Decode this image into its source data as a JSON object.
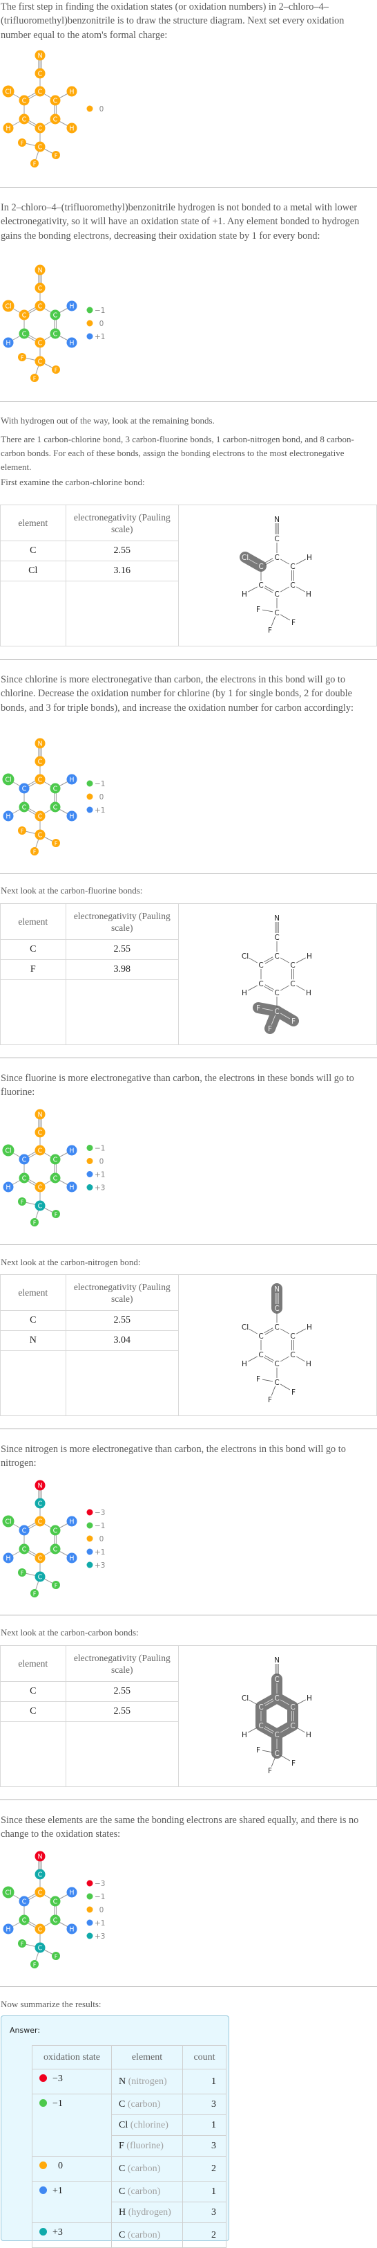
{
  "colors": {
    "minus3": "#f0001e",
    "minus1": "#4cc94c",
    "zero": "#ffa90a",
    "plus1": "#3f88f2",
    "plus3": "#11aaaa",
    "highlight": "#7a7a7a"
  },
  "sections": {
    "intro": {
      "text": "The first step in finding the oxidation states (or oxidation numbers) in 2–chloro–4–(trifluoromethyl)benzonitrile is to draw the structure diagram. Next set every oxidation number equal to the atom's formal charge:",
      "legend": [
        {
          "label": "0",
          "color_key": "zero"
        }
      ]
    },
    "hydrogen": {
      "text": "In 2–chloro–4–(trifluoromethyl)benzonitrile hydrogen is not bonded to a metal with lower electronegativity, so it will have an oxidation state of +1. Any element bonded to hydrogen gains the bonding electrons, decreasing their oxidation state by 1 for every bond:",
      "legend": [
        {
          "label": "−1",
          "color_key": "minus1"
        },
        {
          "label": "0",
          "color_key": "zero"
        },
        {
          "label": "+1",
          "color_key": "plus1"
        }
      ]
    },
    "remaining": {
      "line1": "With hydrogen out of the way, look at the remaining bonds.",
      "line2": "There are 1 carbon-chlorine bond, 3 carbon-fluorine bonds, 1 carbon-nitrogen bond, and 8 carbon-carbon bonds.  For each of these bonds, assign the bonding electrons to the most electronegative element.",
      "line3": "First examine the carbon-chlorine bond:"
    },
    "table_headers": {
      "element": "element",
      "electronegativity": "electronegativity (Pauling scale)"
    },
    "cl_table": {
      "rows": [
        {
          "element": "C",
          "value": "2.55"
        },
        {
          "element": "Cl",
          "value": "3.16"
        }
      ]
    },
    "chlorine": {
      "text": "Since chlorine is more electronegative than carbon, the electrons in this bond will go to chlorine. Decrease the oxidation number for chlorine (by 1 for single bonds, 2 for double bonds, and 3 for triple bonds), and increase the oxidation number for carbon accordingly:",
      "legend": [
        {
          "label": "−1",
          "color_key": "minus1"
        },
        {
          "label": "0",
          "color_key": "zero"
        },
        {
          "label": "+1",
          "color_key": "plus1"
        }
      ]
    },
    "f_intro": "Next look at the carbon-fluorine bonds:",
    "f_table": {
      "rows": [
        {
          "element": "C",
          "value": "2.55"
        },
        {
          "element": "F",
          "value": "3.98"
        }
      ]
    },
    "fluorine": {
      "text": "Since fluorine is more electronegative than carbon, the electrons in these bonds will go to fluorine:",
      "legend": [
        {
          "label": "−1",
          "color_key": "minus1"
        },
        {
          "label": "0",
          "color_key": "zero"
        },
        {
          "label": "+1",
          "color_key": "plus1"
        },
        {
          "label": "+3",
          "color_key": "plus3"
        }
      ]
    },
    "n_intro": "Next look at the carbon-nitrogen bond:",
    "n_table": {
      "rows": [
        {
          "element": "C",
          "value": "2.55"
        },
        {
          "element": "N",
          "value": "3.04"
        }
      ]
    },
    "nitrogen": {
      "text": "Since nitrogen is more electronegative than carbon, the electrons in this bond will go to nitrogen:",
      "legend": [
        {
          "label": "−3",
          "color_key": "minus3"
        },
        {
          "label": "−1",
          "color_key": "minus1"
        },
        {
          "label": "0",
          "color_key": "zero"
        },
        {
          "label": "+1",
          "color_key": "plus1"
        },
        {
          "label": "+3",
          "color_key": "plus3"
        }
      ]
    },
    "c_intro": "Next look at the carbon-carbon bonds:",
    "c_table": {
      "rows": [
        {
          "element": "C",
          "value": "2.55"
        },
        {
          "element": "C",
          "value": "2.55"
        }
      ]
    },
    "carbon": {
      "text": "Since these elements are the same the bonding electrons are shared equally, and there is no change to the oxidation states:",
      "legend": [
        {
          "label": "−3",
          "color_key": "minus3"
        },
        {
          "label": "−1",
          "color_key": "minus1"
        },
        {
          "label": "0",
          "color_key": "zero"
        },
        {
          "label": "+1",
          "color_key": "plus1"
        },
        {
          "label": "+3",
          "color_key": "plus3"
        }
      ]
    },
    "summary_intro": "Now summarize the results:"
  },
  "molecule": {
    "atoms": [
      {
        "id": "N",
        "label": "N"
      },
      {
        "id": "Cn",
        "label": "C"
      },
      {
        "id": "C1",
        "label": "C"
      },
      {
        "id": "Cl",
        "label": "Cl"
      },
      {
        "id": "C2",
        "label": "C"
      },
      {
        "id": "C6",
        "label": "C"
      },
      {
        "id": "H6",
        "label": "H"
      },
      {
        "id": "C3",
        "label": "C"
      },
      {
        "id": "C5",
        "label": "C"
      },
      {
        "id": "C4",
        "label": "C"
      },
      {
        "id": "H3",
        "label": "H"
      },
      {
        "id": "H5",
        "label": "H"
      },
      {
        "id": "Cf",
        "label": "C"
      },
      {
        "id": "F1",
        "label": "F"
      },
      {
        "id": "F2",
        "label": "F"
      },
      {
        "id": "F3",
        "label": "F"
      }
    ],
    "bonds": [
      {
        "a": "N",
        "b": "Cn",
        "order": 3
      },
      {
        "a": "Cn",
        "b": "C1",
        "order": 1
      },
      {
        "a": "C1",
        "b": "C2",
        "order": 2
      },
      {
        "a": "C1",
        "b": "C6",
        "order": 1
      },
      {
        "a": "C2",
        "b": "Cl",
        "order": 1
      },
      {
        "a": "C2",
        "b": "C3",
        "order": 1
      },
      {
        "a": "C6",
        "b": "H6",
        "order": 1
      },
      {
        "a": "C6",
        "b": "C5",
        "order": 2
      },
      {
        "a": "C3",
        "b": "C4",
        "order": 2
      },
      {
        "a": "C3",
        "b": "H3",
        "order": 1
      },
      {
        "a": "C5",
        "b": "C4",
        "order": 1
      },
      {
        "a": "C5",
        "b": "H5",
        "order": 1
      },
      {
        "a": "C4",
        "b": "Cf",
        "order": 1
      },
      {
        "a": "Cf",
        "b": "F1",
        "order": 1
      },
      {
        "a": "Cf",
        "b": "F2",
        "order": 1
      },
      {
        "a": "Cf",
        "b": "F3",
        "order": 1
      }
    ],
    "states": {
      "intro": {
        "N": "zero",
        "Cn": "zero",
        "C1": "zero",
        "Cl": "zero",
        "C2": "zero",
        "C6": "zero",
        "H6": "zero",
        "C3": "zero",
        "C5": "zero",
        "C4": "zero",
        "H3": "zero",
        "H5": "zero",
        "Cf": "zero",
        "F1": "zero",
        "F2": "zero",
        "F3": "zero"
      },
      "hydrogen": {
        "N": "zero",
        "Cn": "zero",
        "C1": "zero",
        "Cl": "zero",
        "C2": "zero",
        "C6": "minus1",
        "H6": "plus1",
        "C3": "minus1",
        "C5": "minus1",
        "C4": "zero",
        "H3": "plus1",
        "H5": "plus1",
        "Cf": "zero",
        "F1": "zero",
        "F2": "zero",
        "F3": "zero"
      },
      "chlorine": {
        "N": "zero",
        "Cn": "zero",
        "C1": "zero",
        "Cl": "minus1",
        "C2": "plus1",
        "C6": "minus1",
        "H6": "plus1",
        "C3": "minus1",
        "C5": "minus1",
        "C4": "zero",
        "H3": "plus1",
        "H5": "plus1",
        "Cf": "zero",
        "F1": "zero",
        "F2": "zero",
        "F3": "zero"
      },
      "fluorine": {
        "N": "zero",
        "Cn": "zero",
        "C1": "zero",
        "Cl": "minus1",
        "C2": "plus1",
        "C6": "minus1",
        "H6": "plus1",
        "C3": "minus1",
        "C5": "minus1",
        "C4": "zero",
        "H3": "plus1",
        "H5": "plus1",
        "Cf": "plus3",
        "F1": "minus1",
        "F2": "minus1",
        "F3": "minus1"
      },
      "nitrogen": {
        "N": "minus3",
        "Cn": "plus3",
        "C1": "zero",
        "Cl": "minus1",
        "C2": "plus1",
        "C6": "minus1",
        "H6": "plus1",
        "C3": "minus1",
        "C5": "minus1",
        "C4": "zero",
        "H3": "plus1",
        "H5": "plus1",
        "Cf": "plus3",
        "F1": "minus1",
        "F2": "minus1",
        "F3": "minus1"
      },
      "carbon": {
        "N": "minus3",
        "Cn": "plus3",
        "C1": "zero",
        "Cl": "minus1",
        "C2": "plus1",
        "C6": "minus1",
        "H6": "plus1",
        "C3": "minus1",
        "C5": "minus1",
        "C4": "zero",
        "H3": "plus1",
        "H5": "plus1",
        "Cf": "plus3",
        "F1": "minus1",
        "F2": "minus1",
        "F3": "minus1"
      }
    },
    "highlights": {
      "cl_table": [
        [
          "Cl",
          "C2"
        ]
      ],
      "f_table": [
        [
          "Cf",
          "F1"
        ],
        [
          "Cf",
          "F2"
        ],
        [
          "Cf",
          "F3"
        ]
      ],
      "n_table": [
        [
          "N",
          "Cn"
        ]
      ],
      "c_table": [
        [
          "Cn",
          "C1"
        ],
        [
          "C1",
          "C2"
        ],
        [
          "C2",
          "C3"
        ],
        [
          "C3",
          "C4"
        ],
        [
          "C4",
          "C5"
        ],
        [
          "C5",
          "C6"
        ],
        [
          "C6",
          "C1"
        ],
        [
          "C4",
          "Cf"
        ]
      ]
    }
  },
  "answer": {
    "label": "Answer:",
    "headers": {
      "state": "oxidation state",
      "element": "element",
      "count": "count"
    },
    "groups": [
      {
        "state": "−3",
        "color_key": "minus3",
        "rows": [
          {
            "symbol": "N",
            "name": "(nitrogen)",
            "count": "1"
          }
        ]
      },
      {
        "state": "−1",
        "color_key": "minus1",
        "rows": [
          {
            "symbol": "C",
            "name": "(carbon)",
            "count": "3"
          },
          {
            "symbol": "Cl",
            "name": "(chlorine)",
            "count": "1"
          },
          {
            "symbol": "F",
            "name": "(fluorine)",
            "count": "3"
          }
        ]
      },
      {
        "state": "0",
        "color_key": "zero",
        "rows": [
          {
            "symbol": "C",
            "name": "(carbon)",
            "count": "2"
          }
        ]
      },
      {
        "state": "+1",
        "color_key": "plus1",
        "rows": [
          {
            "symbol": "C",
            "name": "(carbon)",
            "count": "1"
          },
          {
            "symbol": "H",
            "name": "(hydrogen)",
            "count": "3"
          }
        ]
      },
      {
        "state": "+3",
        "color_key": "plus3",
        "rows": [
          {
            "symbol": "C",
            "name": "(carbon)",
            "count": "2"
          }
        ]
      }
    ]
  }
}
